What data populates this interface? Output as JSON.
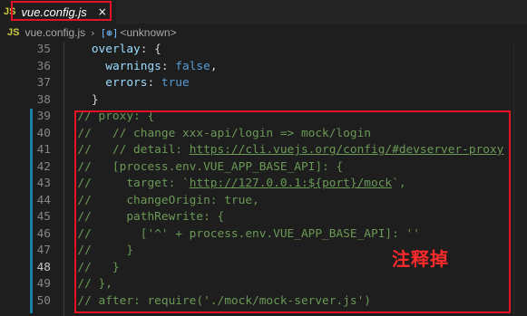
{
  "tab": {
    "lang_badge": "JS",
    "filename": "vue.config.js",
    "close_glyph": "×"
  },
  "breadcrumb": {
    "lang_badge": "JS",
    "file": "vue.config.js",
    "separator": "›",
    "symbol_icon": "[⊛]",
    "symbol": "<unknown>"
  },
  "annotation": "注释掉",
  "colors": {
    "annotation_red": "#e81123",
    "comment_green": "#6a9955",
    "modified_bar": "#1b81a8"
  },
  "lines": [
    {
      "n": "35",
      "tokens": [
        [
          "p",
          "    "
        ],
        [
          "k",
          "overlay"
        ],
        [
          "p",
          ": {"
        ]
      ]
    },
    {
      "n": "36",
      "tokens": [
        [
          "p",
          "      "
        ],
        [
          "k",
          "warnings"
        ],
        [
          "p",
          ": "
        ],
        [
          "b",
          "false"
        ],
        [
          "p",
          ","
        ]
      ]
    },
    {
      "n": "37",
      "tokens": [
        [
          "p",
          "      "
        ],
        [
          "k",
          "errors"
        ],
        [
          "p",
          ": "
        ],
        [
          "b",
          "true"
        ]
      ]
    },
    {
      "n": "38",
      "tokens": [
        [
          "p",
          "    }"
        ]
      ]
    },
    {
      "n": "39",
      "tokens": [
        [
          "c",
          "  // proxy: {"
        ]
      ]
    },
    {
      "n": "40",
      "tokens": [
        [
          "c",
          "  //   // change xxx-api/login => mock/login"
        ]
      ]
    },
    {
      "n": "41",
      "tokens": [
        [
          "c",
          "  //   // detail: "
        ],
        [
          "c-link",
          "https://cli.vuejs.org/config/#devserver-proxy"
        ]
      ]
    },
    {
      "n": "42",
      "tokens": [
        [
          "c",
          "  //   [process.env.VUE_APP_BASE_API]: {"
        ]
      ]
    },
    {
      "n": "43",
      "tokens": [
        [
          "c",
          "  //     target: `"
        ],
        [
          "c-link",
          "http://127.0.0.1:${port}/mock"
        ],
        [
          "c",
          "`,"
        ]
      ]
    },
    {
      "n": "44",
      "tokens": [
        [
          "c",
          "  //     changeOrigin: true,"
        ]
      ]
    },
    {
      "n": "45",
      "tokens": [
        [
          "c",
          "  //     pathRewrite: {"
        ]
      ]
    },
    {
      "n": "46",
      "tokens": [
        [
          "c",
          "  //       ['^' + process.env.VUE_APP_BASE_API]: ''"
        ]
      ]
    },
    {
      "n": "47",
      "tokens": [
        [
          "c",
          "  //     }"
        ]
      ]
    },
    {
      "n": "48",
      "tokens": [
        [
          "c",
          "  //   }"
        ]
      ],
      "active": true
    },
    {
      "n": "49",
      "tokens": [
        [
          "c",
          "  // },"
        ]
      ]
    },
    {
      "n": "50",
      "tokens": [
        [
          "c",
          "  // after: require('./mock/mock-server.js')"
        ]
      ]
    }
  ]
}
